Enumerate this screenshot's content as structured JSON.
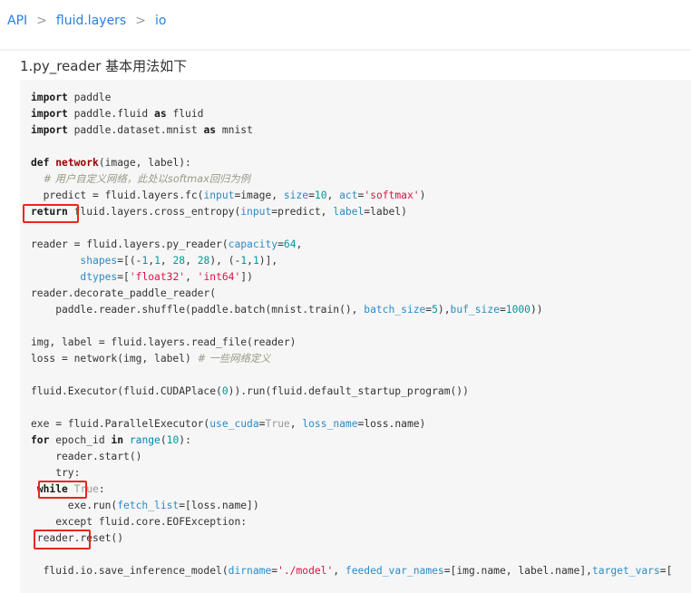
{
  "breadcrumb": {
    "items": [
      "API",
      "fluid.layers",
      "io"
    ],
    "separator": ">"
  },
  "heading": "1.py_reader 基本用法如下",
  "code": {
    "lines": [
      [
        {
          "t": "import",
          "c": "kw"
        },
        {
          "t": " paddle"
        }
      ],
      [
        {
          "t": "import",
          "c": "kw"
        },
        {
          "t": " paddle.fluid "
        },
        {
          "t": "as",
          "c": "kw"
        },
        {
          "t": " fluid"
        }
      ],
      [
        {
          "t": "import",
          "c": "kw"
        },
        {
          "t": " paddle.dataset.mnist "
        },
        {
          "t": "as",
          "c": "kw"
        },
        {
          "t": " mnist"
        }
      ],
      [],
      [
        {
          "t": "def",
          "c": "kw"
        },
        {
          "t": " "
        },
        {
          "t": "network",
          "c": "fn"
        },
        {
          "t": "(image, label):"
        }
      ],
      [
        {
          "t": "  "
        },
        {
          "t": "# 用户自定义网络，此处以softmax回归为例",
          "c": "cmt"
        }
      ],
      [
        {
          "t": "  predict = fluid.layers.fc("
        },
        {
          "t": "input",
          "c": "par"
        },
        {
          "t": "=image, "
        },
        {
          "t": "size",
          "c": "par"
        },
        {
          "t": "="
        },
        {
          "t": "10",
          "c": "num"
        },
        {
          "t": ", "
        },
        {
          "t": "act",
          "c": "par"
        },
        {
          "t": "="
        },
        {
          "t": "'softmax'",
          "c": "str"
        },
        {
          "t": ")"
        }
      ],
      [
        {
          "t": "return",
          "c": "kw"
        },
        {
          "t": " fluid.layers.cross_entropy("
        },
        {
          "t": "input",
          "c": "par"
        },
        {
          "t": "=predict, "
        },
        {
          "t": "label",
          "c": "par"
        },
        {
          "t": "=label)"
        }
      ],
      [],
      [
        {
          "t": "reader = fluid.layers.py_reader("
        },
        {
          "t": "capacity",
          "c": "par"
        },
        {
          "t": "="
        },
        {
          "t": "64",
          "c": "num"
        },
        {
          "t": ","
        }
      ],
      [
        {
          "t": "        "
        },
        {
          "t": "shapes",
          "c": "par"
        },
        {
          "t": "=[(-"
        },
        {
          "t": "1",
          "c": "num"
        },
        {
          "t": ","
        },
        {
          "t": "1",
          "c": "num"
        },
        {
          "t": ", "
        },
        {
          "t": "28",
          "c": "num"
        },
        {
          "t": ", "
        },
        {
          "t": "28",
          "c": "num"
        },
        {
          "t": "), (-"
        },
        {
          "t": "1",
          "c": "num"
        },
        {
          "t": ","
        },
        {
          "t": "1",
          "c": "num"
        },
        {
          "t": ")],"
        }
      ],
      [
        {
          "t": "        "
        },
        {
          "t": "dtypes",
          "c": "par"
        },
        {
          "t": "=["
        },
        {
          "t": "'float32'",
          "c": "str"
        },
        {
          "t": ", "
        },
        {
          "t": "'int64'",
          "c": "str"
        },
        {
          "t": "])"
        }
      ],
      [
        {
          "t": "reader.decorate_paddle_reader("
        }
      ],
      [
        {
          "t": "    paddle.reader.shuffle(paddle.batch(mnist.train(), "
        },
        {
          "t": "batch_size",
          "c": "par"
        },
        {
          "t": "="
        },
        {
          "t": "5",
          "c": "num"
        },
        {
          "t": "),"
        },
        {
          "t": "buf_size",
          "c": "par"
        },
        {
          "t": "="
        },
        {
          "t": "1000",
          "c": "num"
        },
        {
          "t": "))"
        }
      ],
      [],
      [
        {
          "t": "img, label = fluid.layers.read_file(reader)"
        }
      ],
      [
        {
          "t": "loss = network(img, label) "
        },
        {
          "t": "# 一些网络定义",
          "c": "cmt"
        }
      ],
      [],
      [
        {
          "t": "fluid.Executor(fluid.CUDAPlace("
        },
        {
          "t": "0",
          "c": "num"
        },
        {
          "t": ")).run(fluid.default_startup_program())"
        }
      ],
      [],
      [
        {
          "t": "exe = fluid.ParallelExecutor("
        },
        {
          "t": "use_cuda",
          "c": "par"
        },
        {
          "t": "="
        },
        {
          "t": "True",
          "c": "tru"
        },
        {
          "t": ", "
        },
        {
          "t": "loss_name",
          "c": "par"
        },
        {
          "t": "=loss.name)"
        }
      ],
      [
        {
          "t": "for",
          "c": "kw"
        },
        {
          "t": " epoch_id "
        },
        {
          "t": "in",
          "c": "kw"
        },
        {
          "t": " "
        },
        {
          "t": "range",
          "c": "bi"
        },
        {
          "t": "("
        },
        {
          "t": "10",
          "c": "num"
        },
        {
          "t": "):"
        }
      ],
      [
        {
          "t": "    reader.start()"
        }
      ],
      [
        {
          "t": "    try:"
        }
      ],
      [
        {
          "t": " "
        },
        {
          "t": "while",
          "c": "kw"
        },
        {
          "t": " "
        },
        {
          "t": "True",
          "c": "tru"
        },
        {
          "t": ":"
        }
      ],
      [
        {
          "t": "      exe.run("
        },
        {
          "t": "fetch_list",
          "c": "par"
        },
        {
          "t": "=[loss.name])"
        }
      ],
      [
        {
          "t": "    except fluid.core.EOFException:"
        }
      ],
      [
        {
          "t": " reader.reset()"
        }
      ],
      [],
      [
        {
          "t": "  fluid.io.save_inference_model("
        },
        {
          "t": "dirname",
          "c": "par"
        },
        {
          "t": "="
        },
        {
          "t": "'./model'",
          "c": "str"
        },
        {
          "t": ", "
        },
        {
          "t": "feeded_var_names",
          "c": "par"
        },
        {
          "t": "=[img.name, label.name],"
        },
        {
          "t": "target_vars",
          "c": "par"
        },
        {
          "t": "=["
        }
      ]
    ]
  },
  "highlight_color": "#e8281a"
}
